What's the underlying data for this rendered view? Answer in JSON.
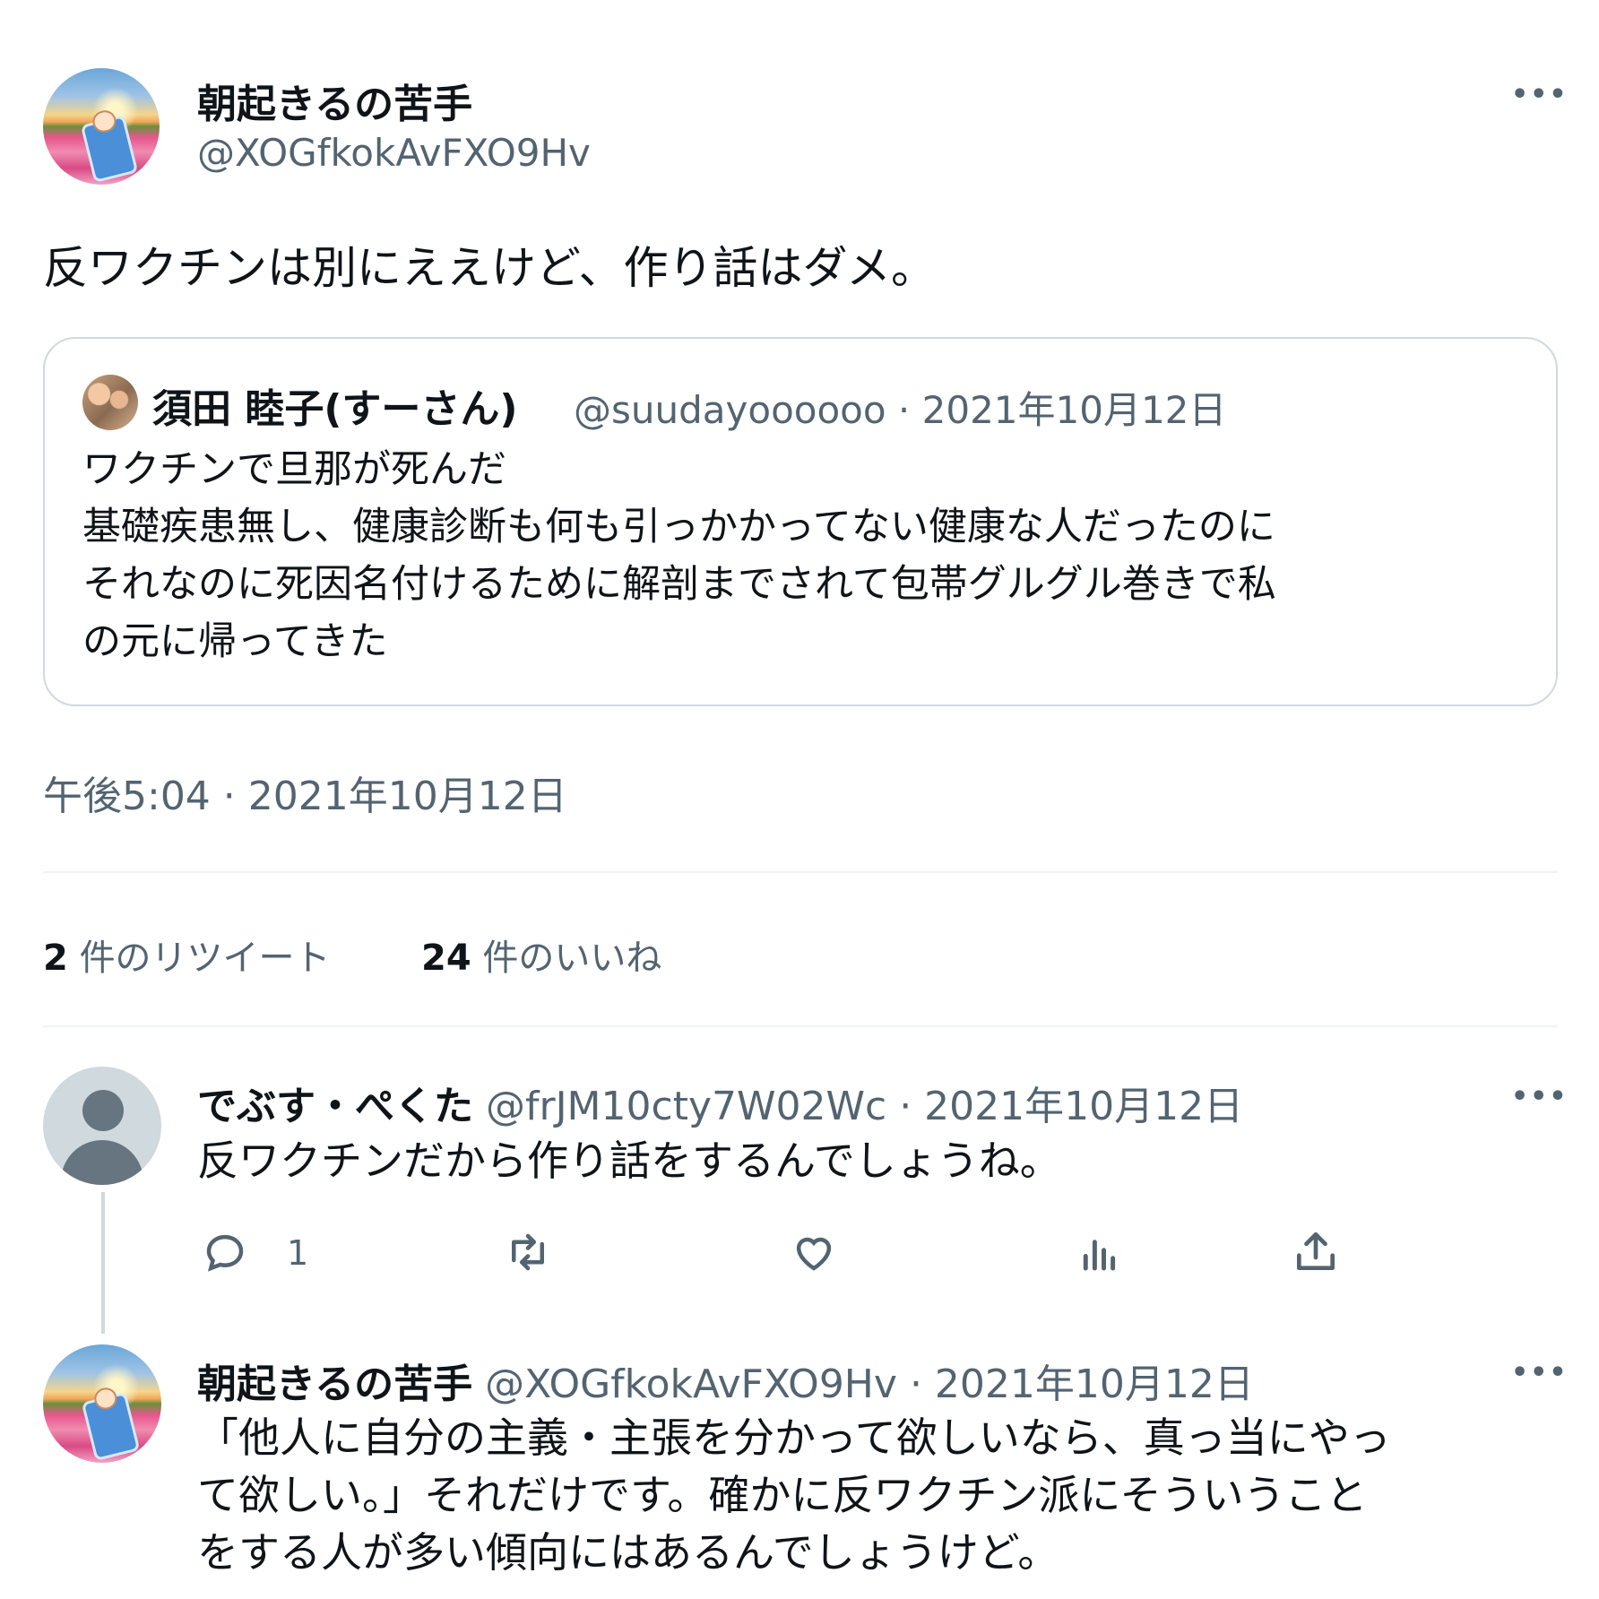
{
  "main_tweet": {
    "display_name": "朝起きるの苦手",
    "handle": "@XOGfkokAvFXO9Hv",
    "text": "反ワクチンは別にええけど、作り話はダメ。",
    "timestamp": "午後5:04 · 2021年10月12日",
    "more_icon": "more-icon",
    "stats": {
      "retweets_count": "2",
      "retweets_label": "件のリツイート",
      "likes_count": "24",
      "likes_label": "件のいいね"
    }
  },
  "quoted_tweet": {
    "display_name": "須田 睦子(すーさん)",
    "handle": "@suudayoooooo",
    "date": "· 2021年10月12日",
    "lines": [
      "ワクチンで旦那が死んだ",
      "基礎疾患無し、健康診断も何も引っかかってない健康な人だったのに",
      "それなのに死因名付けるために解剖までされて包帯グルグル巻きで私",
      "の元に帰ってきた"
    ]
  },
  "replies": [
    {
      "display_name": "でぶす・ぺくた",
      "handle": "@frJM10cty7W02Wc",
      "date": "· 2021年10月12日",
      "text": "反ワクチンだから作り話をするんでしょうね。",
      "actions": {
        "reply_icon": "reply-icon",
        "reply_count": "1",
        "retweet_icon": "retweet-icon",
        "like_icon": "heart-icon",
        "views_icon": "views-icon",
        "share_icon": "share-icon"
      }
    },
    {
      "display_name": "朝起きるの苦手",
      "handle": "@XOGfkokAvFXO9Hv",
      "date": "· 2021年10月12日",
      "lines": [
        "「他人に自分の主義・主張を分かって欲しいなら、真っ当にやっ",
        "て欲しい。」それだけです。確かに反ワクチン派にそういうこと",
        "をする人が多い傾向にはあるんでしょうけど。"
      ]
    }
  ],
  "colors": {
    "text": "#0f1419",
    "secondary": "#536471",
    "border": "#cfd9de",
    "divider": "#eff3f4"
  }
}
